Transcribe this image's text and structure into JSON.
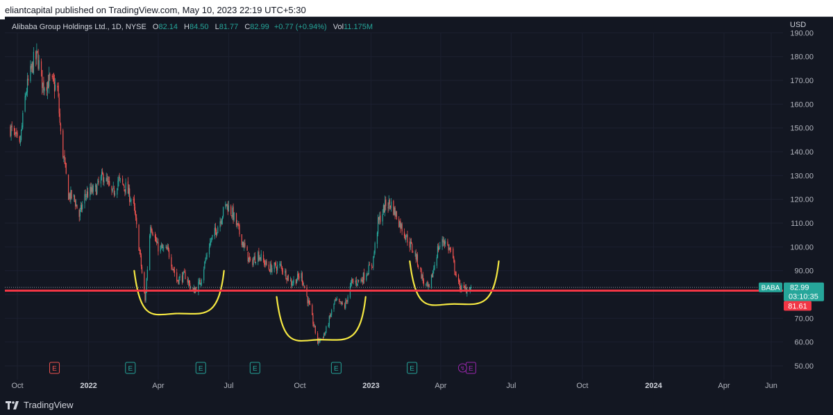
{
  "header": {
    "published": "eliantcapital published on TradingView.com, May 10, 2023 22:19 UTC+5:30"
  },
  "legend": {
    "symbol": "Alibaba Group Holdings Ltd., 1D, NYSE",
    "open_label": "O",
    "open": "82.14",
    "high_label": "H",
    "high": "84.50",
    "low_label": "L",
    "low": "81.77",
    "close_label": "C",
    "close": "82.99",
    "change": "+0.77 (+0.94%)",
    "vol_label": "Vol",
    "vol": "11.175M"
  },
  "currency": "USD",
  "price_tags": {
    "ticker": "BABA",
    "last": "82.99",
    "countdown": "03:10:35",
    "line_value": "81.61"
  },
  "footer": {
    "brand": "TradingView"
  },
  "colors": {
    "up": "#26a69a",
    "down": "#ef5350",
    "line": "#f23645",
    "annotation": "#f5e842",
    "bg": "#131722"
  },
  "chart_data": {
    "type": "candlestick",
    "title": "Alibaba Group Holdings Ltd., 1D, NYSE",
    "ylabel": "USD",
    "ylim": [
      45,
      195
    ],
    "y_ticks": [
      50,
      60,
      70,
      80,
      90,
      100,
      110,
      120,
      130,
      140,
      150,
      160,
      170,
      180,
      190
    ],
    "y_tick_labels": [
      "50.00",
      "60.00",
      "70.00",
      "80.00",
      "90.00",
      "100.00",
      "110.00",
      "120.00",
      "130.00",
      "140.00",
      "150.00",
      "160.00",
      "170.00",
      "180.00",
      "190.00"
    ],
    "x_ticks": [
      {
        "label": "Oct",
        "date": "2021-10-01"
      },
      {
        "label": "2022",
        "date": "2022-01-01"
      },
      {
        "label": "Apr",
        "date": "2022-04-01"
      },
      {
        "label": "Jul",
        "date": "2022-07-01"
      },
      {
        "label": "Oct",
        "date": "2022-10-01"
      },
      {
        "label": "2023",
        "date": "2023-01-01"
      },
      {
        "label": "Apr",
        "date": "2023-04-01"
      },
      {
        "label": "Jul",
        "date": "2023-07-01"
      },
      {
        "label": "Oct",
        "date": "2023-10-01"
      },
      {
        "label": "2024",
        "date": "2024-01-01"
      },
      {
        "label": "Apr",
        "date": "2024-04-01"
      },
      {
        "label": "Jun",
        "date": "2024-06-01"
      }
    ],
    "price_path": [
      [
        "2021-09-22",
        150
      ],
      [
        "2021-10-04",
        142
      ],
      [
        "2021-10-12",
        165
      ],
      [
        "2021-10-22",
        178
      ],
      [
        "2021-10-27",
        180
      ],
      [
        "2021-11-03",
        168
      ],
      [
        "2021-11-12",
        170
      ],
      [
        "2021-11-22",
        166
      ],
      [
        "2021-11-26",
        147
      ],
      [
        "2021-12-06",
        122
      ],
      [
        "2021-12-14",
        120
      ],
      [
        "2021-12-20",
        113
      ],
      [
        "2021-12-28",
        122
      ],
      [
        "2022-01-10",
        124
      ],
      [
        "2022-01-20",
        130
      ],
      [
        "2022-02-01",
        122
      ],
      [
        "2022-02-08",
        128
      ],
      [
        "2022-02-18",
        125
      ],
      [
        "2022-02-28",
        118
      ],
      [
        "2022-03-08",
        98
      ],
      [
        "2022-03-15",
        77
      ],
      [
        "2022-03-22",
        110
      ],
      [
        "2022-03-31",
        100
      ],
      [
        "2022-04-14",
        98
      ],
      [
        "2022-04-25",
        86
      ],
      [
        "2022-05-06",
        88
      ],
      [
        "2022-05-16",
        81
      ],
      [
        "2022-05-25",
        85
      ],
      [
        "2022-06-06",
        101
      ],
      [
        "2022-06-16",
        108
      ],
      [
        "2022-06-28",
        118
      ],
      [
        "2022-07-06",
        114
      ],
      [
        "2022-07-18",
        103
      ],
      [
        "2022-07-29",
        93
      ],
      [
        "2022-08-08",
        97
      ],
      [
        "2022-08-22",
        91
      ],
      [
        "2022-09-06",
        92
      ],
      [
        "2022-09-20",
        85
      ],
      [
        "2022-10-03",
        88
      ],
      [
        "2022-10-14",
        74
      ],
      [
        "2022-10-24",
        60
      ],
      [
        "2022-11-03",
        64
      ],
      [
        "2022-11-15",
        77
      ],
      [
        "2022-11-28",
        75
      ],
      [
        "2022-12-07",
        85
      ],
      [
        "2022-12-19",
        86
      ],
      [
        "2023-01-03",
        93
      ],
      [
        "2023-01-10",
        110
      ],
      [
        "2023-01-20",
        118
      ],
      [
        "2023-01-27",
        118
      ],
      [
        "2023-02-07",
        110
      ],
      [
        "2023-02-16",
        104
      ],
      [
        "2023-02-28",
        96
      ],
      [
        "2023-03-10",
        85
      ],
      [
        "2023-03-17",
        82
      ],
      [
        "2023-03-28",
        99
      ],
      [
        "2023-04-05",
        103
      ],
      [
        "2023-04-14",
        98
      ],
      [
        "2023-04-24",
        84
      ],
      [
        "2023-05-01",
        82
      ],
      [
        "2023-05-10",
        82.99
      ]
    ],
    "horizontal_line": {
      "value": 81.61,
      "label": "81.61"
    },
    "last_price": {
      "value": 82.99,
      "label": "82.99",
      "symbol": "BABA",
      "countdown": "03:10:35"
    },
    "annotations": [
      {
        "type": "cup-curve",
        "from": "2022-03-01",
        "to": "2022-06-25",
        "bottom": 72
      },
      {
        "type": "cup-curve",
        "from": "2022-09-01",
        "to": "2022-12-25",
        "bottom": 61
      },
      {
        "type": "cup-curve",
        "from": "2023-02-20",
        "to": "2023-06-15",
        "bottom": 76
      }
    ],
    "events": [
      {
        "date": "2021-11-18",
        "label": "E",
        "kind": "down"
      },
      {
        "date": "2022-02-24",
        "label": "E",
        "kind": "up"
      },
      {
        "date": "2022-05-26",
        "label": "E",
        "kind": "up"
      },
      {
        "date": "2022-08-04",
        "label": "E",
        "kind": "up"
      },
      {
        "date": "2022-11-17",
        "label": "E",
        "kind": "up"
      },
      {
        "date": "2023-02-23",
        "label": "E",
        "kind": "up"
      },
      {
        "date": "2023-05-10",
        "label": "E",
        "kind": "upcoming"
      }
    ]
  }
}
